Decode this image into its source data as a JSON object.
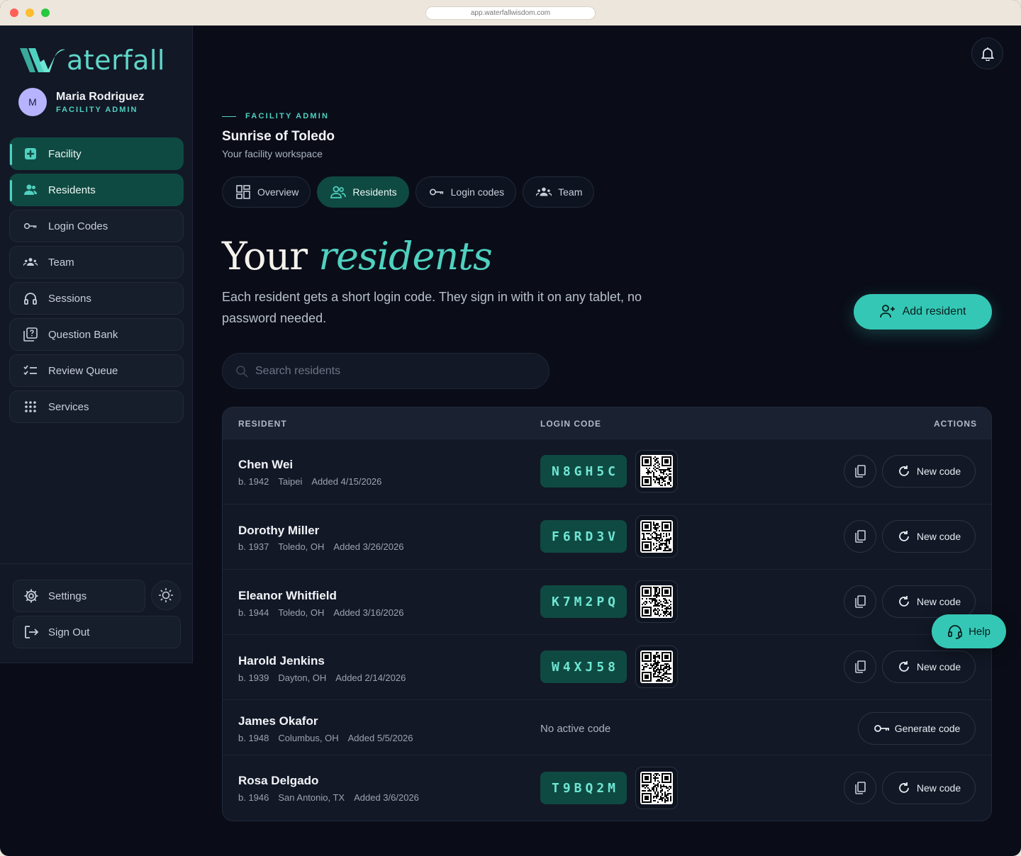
{
  "browser": {
    "url": "app.waterfallwisdom.com"
  },
  "brand": {
    "name": "aterfall",
    "accent": "#4fd1c0"
  },
  "user": {
    "initial": "M",
    "name": "Maria Rodriguez",
    "role": "FACILITY ADMIN"
  },
  "sidebar": {
    "items": [
      {
        "label": "Facility",
        "icon": "plus-square-icon",
        "active": true
      },
      {
        "label": "Residents",
        "icon": "users-icon",
        "active": true
      },
      {
        "label": "Login Codes",
        "icon": "key-icon",
        "active": false
      },
      {
        "label": "Team",
        "icon": "team-icon",
        "active": false
      },
      {
        "label": "Sessions",
        "icon": "headphones-icon",
        "active": false
      },
      {
        "label": "Question Bank",
        "icon": "question-icon",
        "active": false
      },
      {
        "label": "Review Queue",
        "icon": "checklist-icon",
        "active": false
      },
      {
        "label": "Services",
        "icon": "grid-icon",
        "active": false
      }
    ],
    "settings_label": "Settings",
    "signout_label": "Sign Out"
  },
  "header": {
    "eyebrow": "FACILITY ADMIN",
    "facility_name": "Sunrise of Toledo",
    "facility_sub": "Your facility workspace"
  },
  "tabs": [
    {
      "label": "Overview",
      "icon": "dashboard-icon",
      "active": false
    },
    {
      "label": "Residents",
      "icon": "users-icon",
      "active": true
    },
    {
      "label": "Login codes",
      "icon": "key-icon",
      "active": false
    },
    {
      "label": "Team",
      "icon": "team-icon",
      "active": false
    }
  ],
  "main": {
    "heading_plain": "Your",
    "heading_emph": "residents",
    "description": "Each resident gets a short login code. They sign in with it on any tablet, no password needed.",
    "add_button": "Add resident",
    "search_placeholder": "Search residents"
  },
  "table": {
    "headers": {
      "resident": "RESIDENT",
      "login_code": "LOGIN CODE",
      "actions": "ACTIONS"
    },
    "new_code_label": "New code",
    "generate_label": "Generate code",
    "no_code_label": "No active code",
    "rows": [
      {
        "name": "Chen Wei",
        "born": "b. 1942",
        "place": "Taipei",
        "added": "Added 4/15/2026",
        "code": "N8GH5C"
      },
      {
        "name": "Dorothy Miller",
        "born": "b. 1937",
        "place": "Toledo, OH",
        "added": "Added 3/26/2026",
        "code": "F6RD3V"
      },
      {
        "name": "Eleanor Whitfield",
        "born": "b. 1944",
        "place": "Toledo, OH",
        "added": "Added 3/16/2026",
        "code": "K7M2PQ"
      },
      {
        "name": "Harold Jenkins",
        "born": "b. 1939",
        "place": "Dayton, OH",
        "added": "Added 2/14/2026",
        "code": "W4XJ58"
      },
      {
        "name": "James Okafor",
        "born": "b. 1948",
        "place": "Columbus, OH",
        "added": "Added 5/5/2026",
        "code": ""
      },
      {
        "name": "Rosa Delgado",
        "born": "b. 1946",
        "place": "San Antonio, TX",
        "added": "Added 3/6/2026",
        "code": "T9BQ2M"
      }
    ]
  },
  "help_label": "Help"
}
